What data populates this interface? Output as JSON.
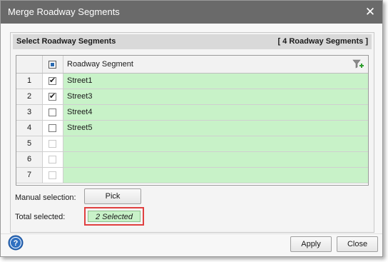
{
  "window": {
    "title": "Merge Roadway Segments",
    "close_glyph": "✕"
  },
  "panel": {
    "title": "Select Roadway Segments",
    "count_label": "[ 4 Roadway Segments ]"
  },
  "grid": {
    "column_header": "Roadway Segment",
    "rows": [
      {
        "num": "1",
        "checked": true,
        "name": "Street1"
      },
      {
        "num": "2",
        "checked": true,
        "name": "Street3"
      },
      {
        "num": "3",
        "checked": false,
        "name": "Street4"
      },
      {
        "num": "4",
        "checked": false,
        "name": "Street5"
      },
      {
        "num": "5",
        "checked": false,
        "name": ""
      },
      {
        "num": "6",
        "checked": false,
        "name": ""
      },
      {
        "num": "7",
        "checked": false,
        "name": ""
      }
    ],
    "row_color": "#c8f2c8",
    "filter_icon": "filter-add-icon"
  },
  "manual_selection": {
    "label": "Manual selection:",
    "button_label": "Pick"
  },
  "total_selected": {
    "label": "Total selected:",
    "value": "2 Selected",
    "highlight_color": "#e04040"
  },
  "footer": {
    "help_icon": "help-icon",
    "apply_label": "Apply",
    "close_label": "Close"
  }
}
